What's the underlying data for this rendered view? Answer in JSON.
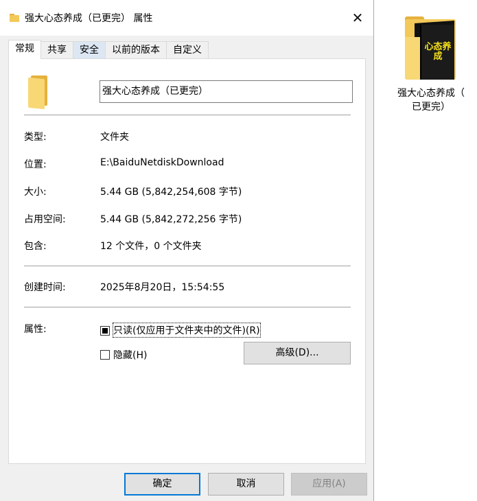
{
  "window": {
    "title": "强大心态养成（已更完） 属性",
    "close_glyph": "✕"
  },
  "tabs": [
    {
      "label": "常规"
    },
    {
      "label": "共享"
    },
    {
      "label": "安全"
    },
    {
      "label": "以前的版本"
    },
    {
      "label": "自定义"
    }
  ],
  "general": {
    "folder_name": "强大心态养成（已更完）",
    "type_label": "类型:",
    "type_value": "文件夹",
    "location_label": "位置:",
    "location_value": "E:\\BaiduNetdiskDownload",
    "size_label": "大小:",
    "size_value": "5.44 GB (5,842,254,608 字节)",
    "size_on_disk_label": "占用空间:",
    "size_on_disk_value": "5.44 GB (5,842,272,256 字节)",
    "contains_label": "包含:",
    "contains_value": "12 个文件，0 个文件夹",
    "created_label": "创建时间:",
    "created_value": "2025年8月20日，15:54:55",
    "attributes_label": "属性:",
    "readonly_label": "只读(仅应用于文件夹中的文件)(R)",
    "hidden_label": "隐藏(H)",
    "advanced_button": "高级(D)..."
  },
  "footer": {
    "ok_button": "确定",
    "cancel_button": "取消",
    "apply_button": "应用(A)"
  },
  "desktop": {
    "icon_label_line1": "强大心态养成（",
    "icon_label_line2": "已更完）",
    "book_text": "心态养成"
  },
  "icons": {
    "title_icon": "folder-icon",
    "close_icon": "close-icon"
  },
  "colors": {
    "accent": "#0078d7",
    "folder_yellow": "#f3c95a",
    "dialog_bg": "#f0f0f0"
  }
}
